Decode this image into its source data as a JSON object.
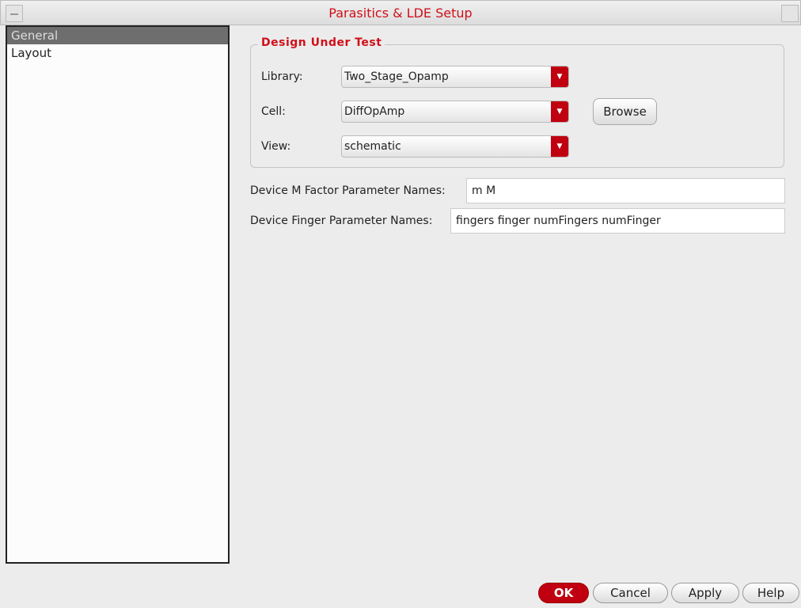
{
  "window": {
    "title": "Parasitics & LDE Setup"
  },
  "sidebar": {
    "items": [
      {
        "label": "General",
        "selected": true
      },
      {
        "label": "Layout",
        "selected": false
      }
    ]
  },
  "dut": {
    "legend": "Design Under Test",
    "library_label": "Library:",
    "library_value": "Two_Stage_Opamp",
    "cell_label": "Cell:",
    "cell_value": "DiffOpAmp",
    "view_label": "View:",
    "view_value": "schematic",
    "browse": "Browse"
  },
  "mfactor": {
    "label": "Device M Factor Parameter Names:",
    "value": "m M"
  },
  "finger": {
    "label": "Device Finger Parameter Names:",
    "value": "fingers finger numFingers numFinger"
  },
  "buttons": {
    "ok": "OK",
    "cancel": "Cancel",
    "apply": "Apply",
    "help": "Help"
  },
  "colors": {
    "accent": "#d0101a"
  }
}
